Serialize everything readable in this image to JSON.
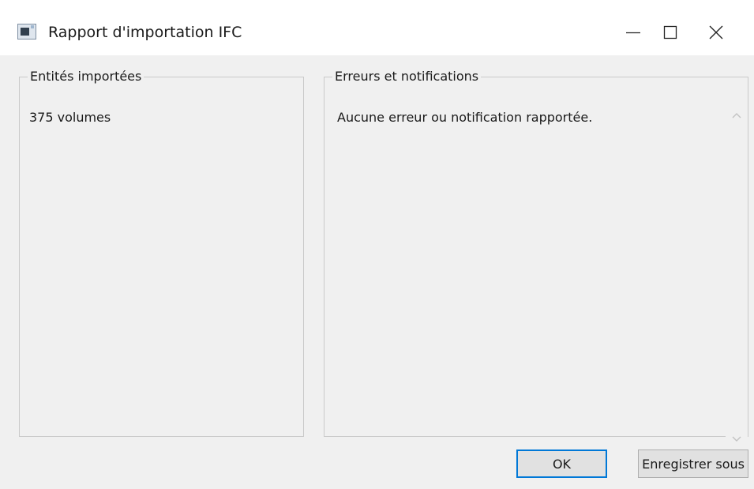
{
  "window": {
    "title": "Rapport d'importation IFC"
  },
  "caption_buttons": {
    "minimize_icon": "minimize-icon",
    "maximize_icon": "maximize-icon",
    "close_icon": "close-icon"
  },
  "imported_entities": {
    "legend": "Entités importées",
    "items": [
      "375 volumes"
    ]
  },
  "errors": {
    "legend": "Erreurs et notifications",
    "message": "Aucune erreur ou notification rapportée."
  },
  "buttons": {
    "ok_label": "OK",
    "save_label": "Enregistrer sous"
  },
  "colors": {
    "accent": "#0078d7",
    "background": "#f0f0f0",
    "titlebar": "#ffffff"
  }
}
